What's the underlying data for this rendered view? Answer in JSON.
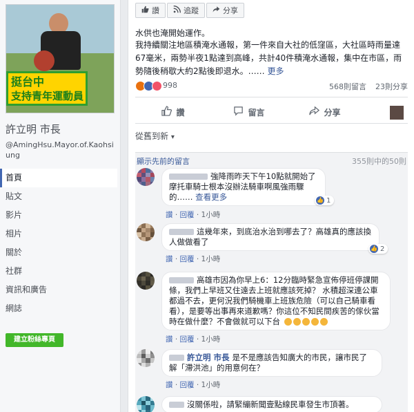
{
  "sidebar": {
    "banner_line1": "挺台中",
    "banner_line2": "支持青年運動員",
    "page_name": "許立明 市長",
    "page_handle": "@AmingHsu.Mayor.of.Kaohsiung",
    "nav": [
      "首頁",
      "貼文",
      "影片",
      "相片",
      "關於",
      "社群",
      "資訊和廣告",
      "網誌"
    ],
    "create_button": "建立粉絲專頁"
  },
  "post": {
    "top_actions": {
      "like": "讚",
      "follow": "追蹤",
      "share": "分享"
    },
    "cut_line": "水供也淹開始運作。",
    "body": "我持續關注地區積淹水通報，第一件來自大社的低窪區，大社區時雨量達67毫米，兩勢半夜1點達到高峰，共計40件積淹水通報，集中在市區，雨勢隨後稍歇大約2點後即退水。……",
    "see_more": "更多",
    "reaction_count": "998",
    "comment_count": "568則留言",
    "share_count": "23則分享",
    "actions": {
      "like": "讚",
      "comment": "留言",
      "share": "分享"
    },
    "sort_label": "從舊到新"
  },
  "comments_header": {
    "prev": "顯示先前的留言",
    "range": "355則中的50則"
  },
  "comments": [
    {
      "text": "強降雨昨天下午10點就開始了摩托車騎士根本沒辦法騎車啊風強雨驟的……",
      "see_more": "查看更多",
      "likes": "1",
      "like_label": "讚",
      "reply_label": "回覆",
      "time": "1小時"
    },
    {
      "text": "這幾年來，到底治水治到哪去了？高雄真的應該換人做做看了",
      "likes": "2",
      "like_label": "讚",
      "reply_label": "回覆",
      "time": "1小時"
    },
    {
      "text": "高雄市因為你早上6：12分臨時緊急宣佈停班停課開條，我們上早班又住遠去上班就應該死掉？ 水積超深連公車都過不去，更何況我們騎機車上班族危險（可以自己騎車看看），是要等出事再來道歉嗎？你這位不知民間疾苦的傢伙當時在做什麼？不會做就可以下台",
      "like_label": "讚",
      "reply_label": "回覆",
      "time": "1小時"
    },
    {
      "author": "許立明 市長",
      "text": "是不是應該告知廣大的市民，讓市民了解「滯洪池」的用意何在？",
      "like_label": "讚",
      "reply_label": "回覆",
      "time": "1小時"
    },
    {
      "text": "沒關係啦，請緊繃新聞壹點線民車發生市頂著。"
    }
  ]
}
